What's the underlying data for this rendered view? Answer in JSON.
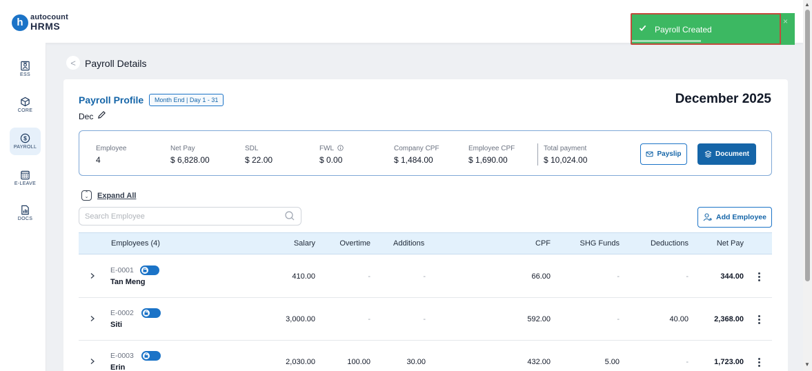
{
  "brand": {
    "top": "autocount",
    "bottom": "HRMS",
    "mark": "h"
  },
  "toast": {
    "message": "Payroll Created",
    "close": "×"
  },
  "sidebar": {
    "items": [
      {
        "label": "ESS",
        "icon": "ess-icon"
      },
      {
        "label": "CORE",
        "icon": "core-icon"
      },
      {
        "label": "PAYROLL",
        "icon": "payroll-icon",
        "active": true
      },
      {
        "label": "E-LEAVE",
        "icon": "calendar-icon"
      },
      {
        "label": "DOCS",
        "icon": "docs-icon"
      }
    ]
  },
  "page": {
    "title": "Payroll Details",
    "back": "<"
  },
  "profile": {
    "title": "Payroll Profile",
    "badge": "Month End | Day 1 - 31",
    "period_name": "Dec",
    "month": "December 2025"
  },
  "summary": {
    "employee": {
      "label": "Employee",
      "value": "4"
    },
    "net_pay": {
      "label": "Net Pay",
      "value": "$ 6,828.00"
    },
    "sdl": {
      "label": "SDL",
      "value": "$ 22.00"
    },
    "fwl": {
      "label": "FWL",
      "value": "$ 0.00"
    },
    "company_cpf": {
      "label": "Company CPF",
      "value": "$ 1,484.00"
    },
    "employee_cpf": {
      "label": "Employee CPF",
      "value": "$ 1,690.00"
    },
    "total_payment": {
      "label": "Total payment",
      "value": "$ 10,024.00"
    },
    "payslip_label": "Payslip",
    "document_label": "Document"
  },
  "toolbar": {
    "expand_all": "Expand All",
    "search_placeholder": "Search Employee",
    "add_employee": "Add Employee"
  },
  "table": {
    "headers": {
      "employees": "Employees (4)",
      "salary": "Salary",
      "overtime": "Overtime",
      "additions": "Additions",
      "cpf": "CPF",
      "shg": "SHG Funds",
      "deductions": "Deductions",
      "net_pay": "Net Pay"
    },
    "rows": [
      {
        "code": "E-0001",
        "name": "Tan Meng",
        "salary": "410.00",
        "overtime": "-",
        "additions": "-",
        "cpf": "66.00",
        "shg": "-",
        "deductions": "-",
        "net_pay": "344.00"
      },
      {
        "code": "E-0002",
        "name": "Siti",
        "salary": "3,000.00",
        "overtime": "-",
        "additions": "-",
        "cpf": "592.00",
        "shg": "-",
        "deductions": "40.00",
        "net_pay": "2,368.00"
      },
      {
        "code": "E-0003",
        "name": "Erin",
        "salary": "2,030.00",
        "overtime": "100.00",
        "additions": "30.00",
        "cpf": "432.00",
        "shg": "5.00",
        "deductions": "-",
        "net_pay": "1,723.00"
      }
    ]
  },
  "colors": {
    "primary": "#1565a8",
    "success": "#3cb862",
    "header_bg": "#e3f1fc"
  }
}
